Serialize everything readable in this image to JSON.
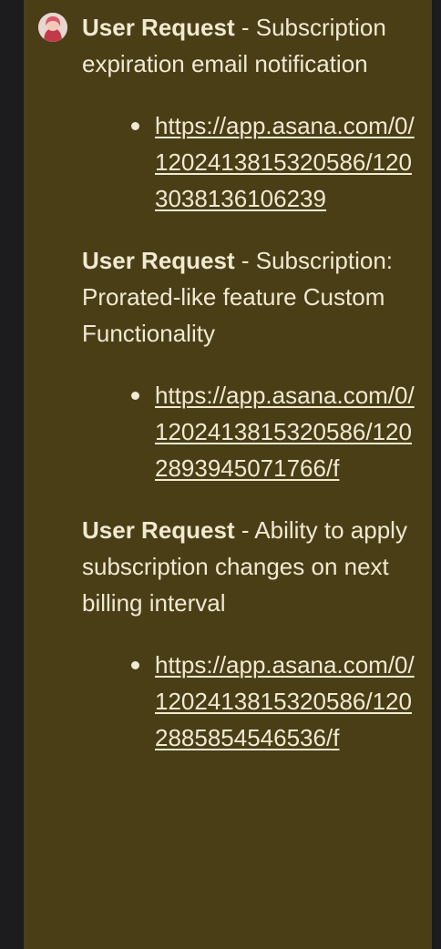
{
  "requests": [
    {
      "title": "User Request",
      "separator": " - ",
      "description": "Subscription expiration email notification",
      "link": "https://app.asana.com/0/1202413815320586/1203038136106239"
    },
    {
      "title": "User Request",
      "separator": " - ",
      "description": "Subscription: Prorated-like feature Custom Functionality",
      "link": "https://app.asana.com/0/1202413815320586/1202893945071766/f"
    },
    {
      "title": "User Request",
      "separator": " - ",
      "description": "Ability to apply subscription changes on next billing interval",
      "link": "https://app.asana.com/0/1202413815320586/1202885854546536/f"
    }
  ]
}
